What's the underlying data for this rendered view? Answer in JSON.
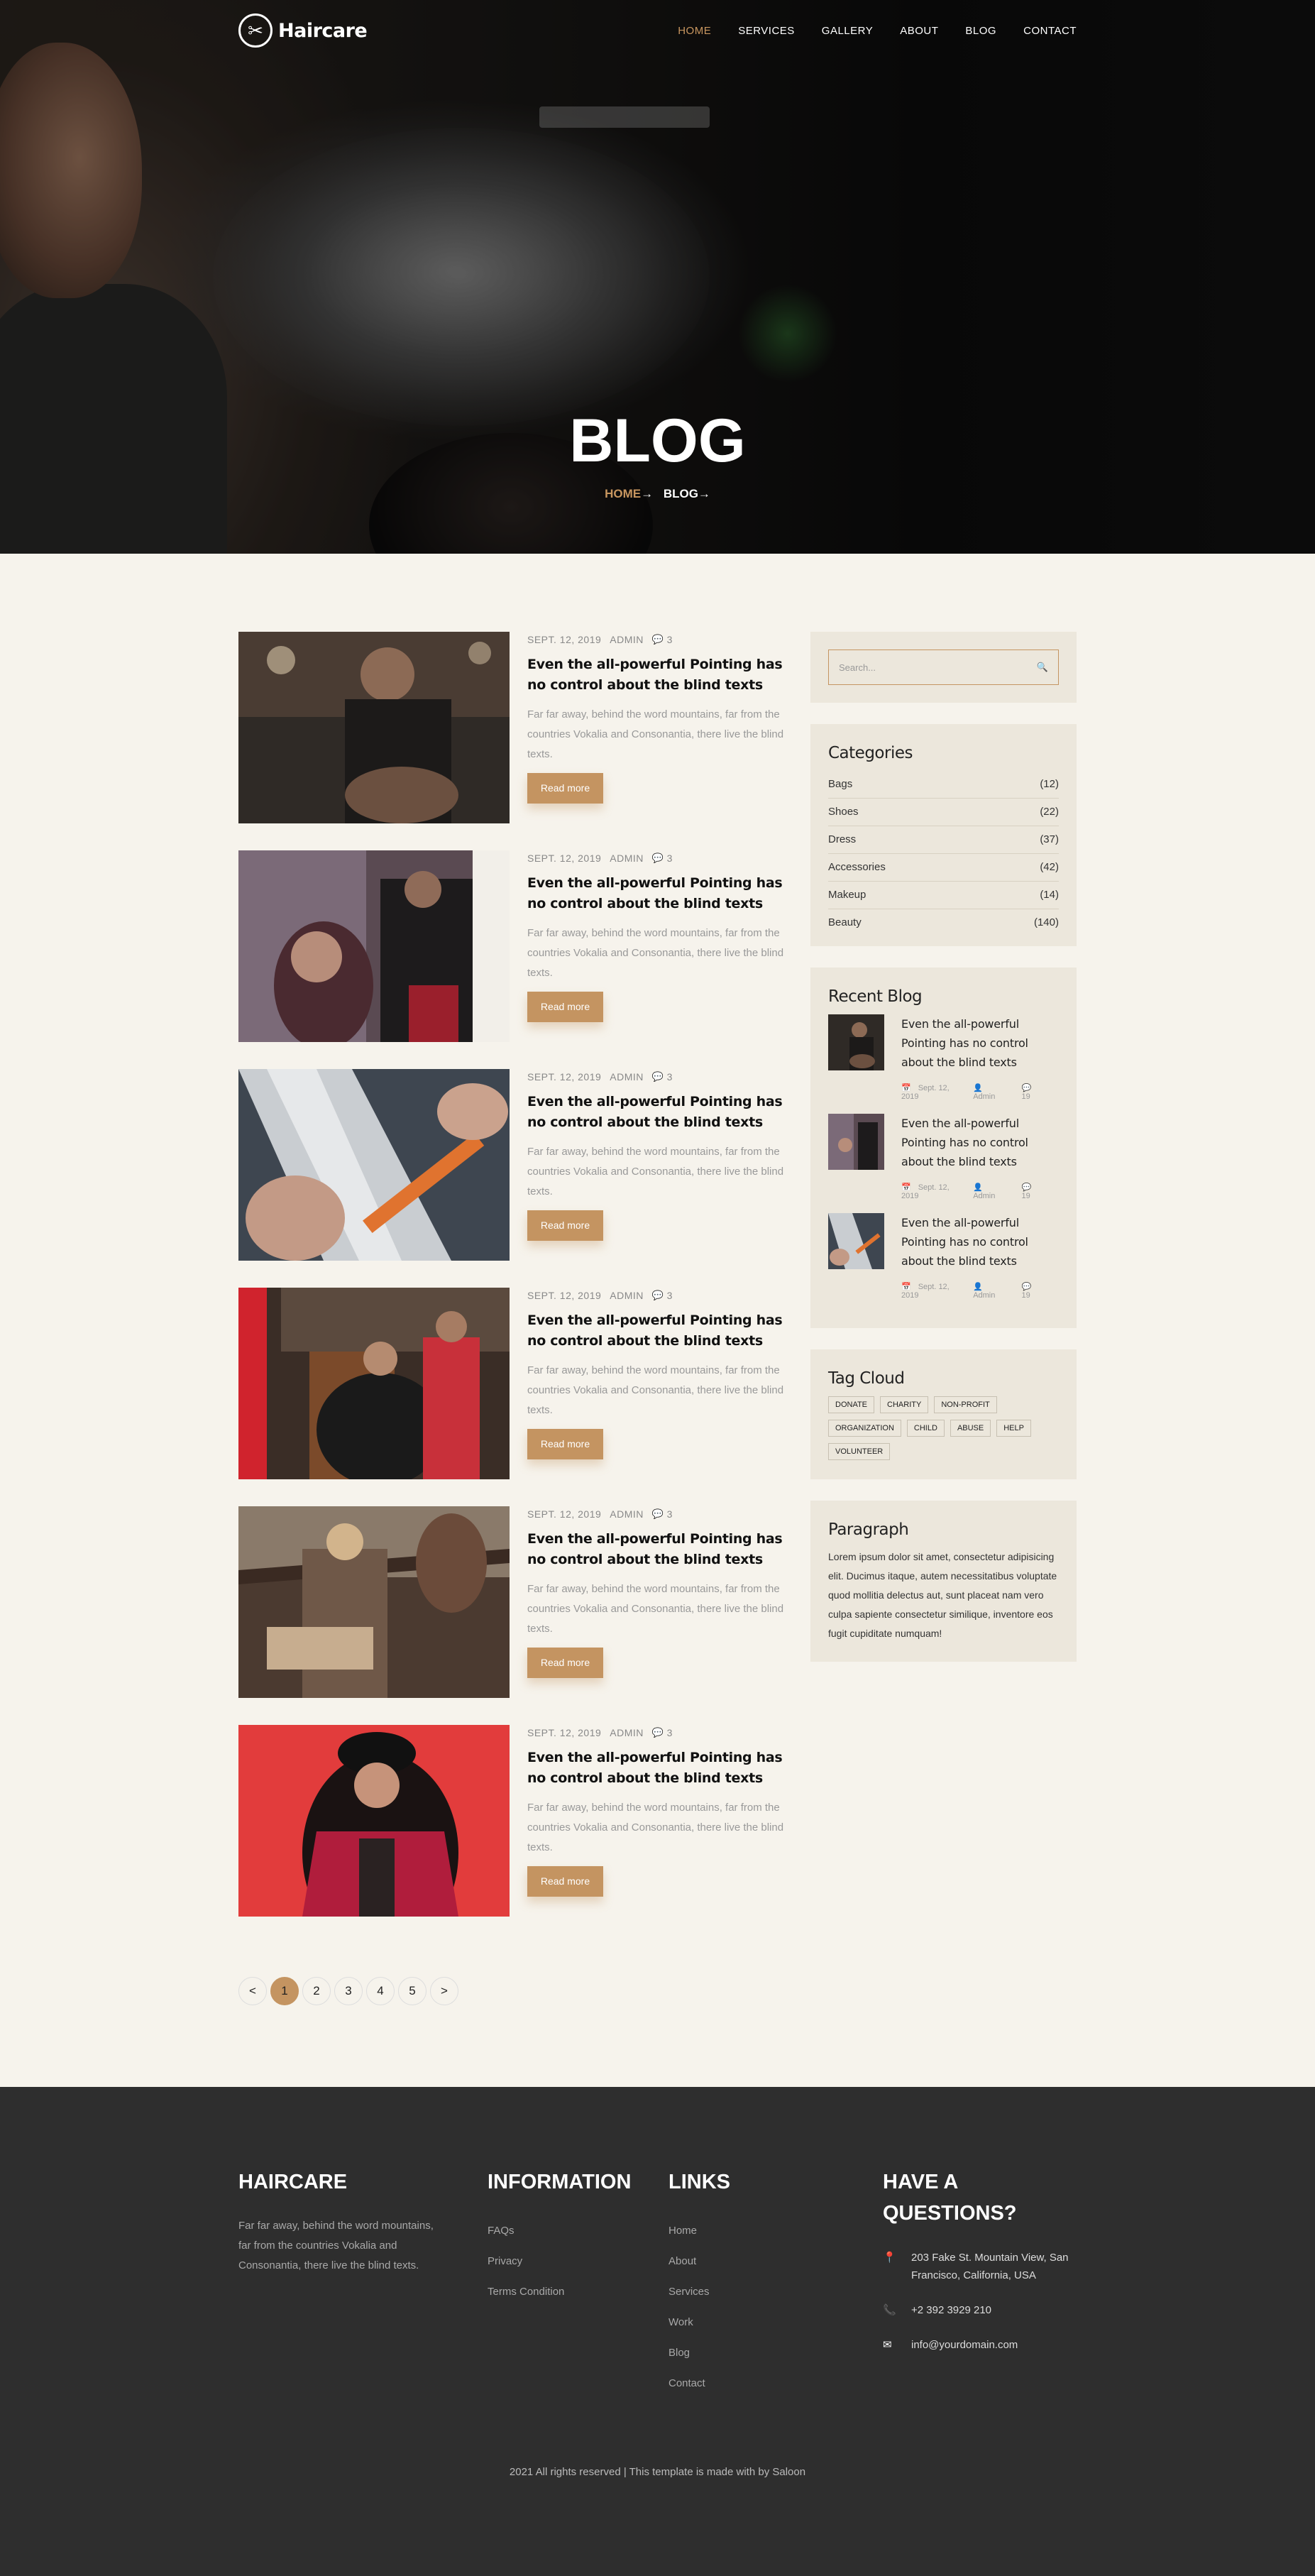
{
  "brand": {
    "name": "Haircare"
  },
  "nav": {
    "items": [
      "HOME",
      "SERVICES",
      "GALLERY",
      "ABOUT",
      "BLOG",
      "CONTACT"
    ],
    "active": "HOME"
  },
  "hero": {
    "title": "BLOG",
    "breadcrumb": {
      "home": "HOME",
      "current": "BLOG",
      "arrow": "→"
    }
  },
  "posts": [
    {
      "date": "SEPT. 12, 2019",
      "author": "ADMIN",
      "comments": "3",
      "title": "Even the all-powerful Pointing has no control about the blind texts",
      "excerpt": "Far far away, behind the word mountains, far from the countries Vokalia and Consonantia, there live the blind texts.",
      "button": "Read more"
    },
    {
      "date": "SEPT. 12, 2019",
      "author": "ADMIN",
      "comments": "3",
      "title": "Even the all-powerful Pointing has no control about the blind texts",
      "excerpt": "Far far away, behind the word mountains, far from the countries Vokalia and Consonantia, there live the blind texts.",
      "button": "Read more"
    },
    {
      "date": "SEPT. 12, 2019",
      "author": "ADMIN",
      "comments": "3",
      "title": "Even the all-powerful Pointing has no control about the blind texts",
      "excerpt": "Far far away, behind the word mountains, far from the countries Vokalia and Consonantia, there live the blind texts.",
      "button": "Read more"
    },
    {
      "date": "SEPT. 12, 2019",
      "author": "ADMIN",
      "comments": "3",
      "title": "Even the all-powerful Pointing has no control about the blind texts",
      "excerpt": "Far far away, behind the word mountains, far from the countries Vokalia and Consonantia, there live the blind texts.",
      "button": "Read more"
    },
    {
      "date": "SEPT. 12, 2019",
      "author": "ADMIN",
      "comments": "3",
      "title": "Even the all-powerful Pointing has no control about the blind texts",
      "excerpt": "Far far away, behind the word mountains, far from the countries Vokalia and Consonantia, there live the blind texts.",
      "button": "Read more"
    },
    {
      "date": "SEPT. 12, 2019",
      "author": "ADMIN",
      "comments": "3",
      "title": "Even the all-powerful Pointing has no control about the blind texts",
      "excerpt": "Far far away, behind the word mountains, far from the countries Vokalia and Consonantia, there live the blind texts.",
      "button": "Read more"
    }
  ],
  "pagination": {
    "prev": "<",
    "pages": [
      "1",
      "2",
      "3",
      "4",
      "5"
    ],
    "current": "1",
    "next": ">"
  },
  "sidebar": {
    "search": {
      "placeholder": "Search..."
    },
    "categories": {
      "title": "Categories",
      "items": [
        {
          "name": "Bags",
          "count": "(12)"
        },
        {
          "name": "Shoes",
          "count": "(22)"
        },
        {
          "name": "Dress",
          "count": "(37)"
        },
        {
          "name": "Accessories",
          "count": "(42)"
        },
        {
          "name": "Makeup",
          "count": "(14)"
        },
        {
          "name": "Beauty",
          "count": "(140)"
        }
      ]
    },
    "recent": {
      "title": "Recent Blog",
      "items": [
        {
          "title": "Even the all-powerful Pointing has no control about the blind texts",
          "date": "Sept. 12, 2019",
          "author": "Admin",
          "comments": "19"
        },
        {
          "title": "Even the all-powerful Pointing has no control about the blind texts",
          "date": "Sept. 12, 2019",
          "author": "Admin",
          "comments": "19"
        },
        {
          "title": "Even the all-powerful Pointing has no control about the blind texts",
          "date": "Sept. 12, 2019",
          "author": "Admin",
          "comments": "19"
        }
      ]
    },
    "tags": {
      "title": "Tag Cloud",
      "items": [
        "DONATE",
        "CHARITY",
        "NON-PROFIT",
        "ORGANIZATION",
        "CHILD",
        "ABUSE",
        "HELP",
        "VOLUNTEER"
      ]
    },
    "paragraph": {
      "title": "Paragraph",
      "text": "Lorem ipsum dolor sit amet, consectetur adipisicing elit. Ducimus itaque, autem necessitatibus voluptate quod mollitia delectus aut, sunt placeat nam vero culpa sapiente consectetur similique, inventore eos fugit cupiditate numquam!"
    }
  },
  "footer": {
    "about": {
      "title": "HAIRCARE",
      "text": "Far far away, behind the word mountains, far from the countries Vokalia and Consonantia, there live the blind texts."
    },
    "information": {
      "title": "INFORMATION",
      "links": [
        "FAQs",
        "Privacy",
        "Terms Condition"
      ]
    },
    "links": {
      "title": "LINKS",
      "links": [
        "Home",
        "About",
        "Services",
        "Work",
        "Blog",
        "Contact"
      ]
    },
    "questions": {
      "title": "HAVE A QUESTIONS?",
      "address": "203 Fake St. Mountain View, San Francisco, California, USA",
      "phone": "+2 392 3929 210",
      "email": "info@yourdomain.com"
    },
    "copyright": "2021 All rights reserved | This template is made with by Saloon"
  },
  "colors": {
    "accent": "#c49461",
    "nav_active": "#c8965f",
    "page_bg": "#f6f3ec",
    "sidebar_bg": "#ece7dc",
    "footer_bg": "#2e2e2e"
  },
  "icons": {
    "comment": "comment-icon",
    "search": "search-icon",
    "calendar": "calendar-icon",
    "user": "user-icon",
    "pin": "map-pin-icon",
    "phone": "phone-icon",
    "mail": "envelope-icon"
  }
}
